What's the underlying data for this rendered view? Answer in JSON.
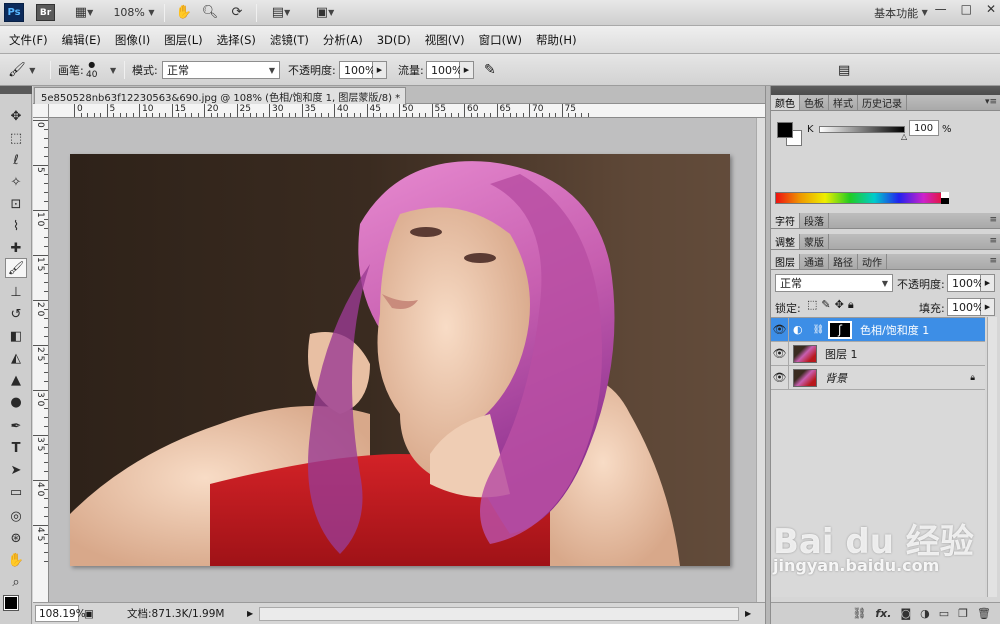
{
  "app_bar": {
    "ps_label": "Ps",
    "br_label": "Br",
    "zoom": "108%",
    "workspace": "基本功能",
    "window_controls": [
      "—",
      "□",
      "✕"
    ]
  },
  "menu": [
    "文件(F)",
    "编辑(E)",
    "图像(I)",
    "图层(L)",
    "选择(S)",
    "滤镜(T)",
    "分析(A)",
    "3D(D)",
    "视图(V)",
    "窗口(W)",
    "帮助(H)"
  ],
  "options": {
    "brush_label": "画笔:",
    "brush_size": "40",
    "mode_label": "模式:",
    "mode_value": "正常",
    "opacity_label": "不透明度:",
    "opacity_value": "100%",
    "flow_label": "流量:",
    "flow_value": "100%"
  },
  "document": {
    "tab_title": "5e850528nb63f12230563&690.jpg @ 108% (色相/饱和度 1, 图层蒙版/8) *",
    "close": "×",
    "ruler_top": [
      "0",
      "5",
      "10",
      "15",
      "20",
      "25",
      "30",
      "35",
      "40",
      "45",
      "50",
      "55",
      "60",
      "65",
      "70",
      "75"
    ],
    "ruler_left": [
      "0",
      "5",
      "1 0",
      "1 5",
      "2 0",
      "2 5",
      "3 0",
      "3 5",
      "4 0",
      "4 5"
    ]
  },
  "status": {
    "zoom": "108.19%",
    "doc_info": "文档:871.3K/1.99M"
  },
  "color_panel": {
    "tabs": [
      "颜色",
      "色板",
      "样式",
      "历史记录"
    ],
    "channel": "K",
    "value": "100",
    "unit": "%"
  },
  "char_panel": {
    "tabs": [
      "字符",
      "段落"
    ]
  },
  "adjust_panel": {
    "tabs": [
      "调整",
      "蒙版"
    ]
  },
  "layers_panel": {
    "tabs": [
      "图层",
      "通道",
      "路径",
      "动作"
    ],
    "blend_mode": "正常",
    "opacity_label": "不透明度:",
    "opacity_value": "100%",
    "lock_label": "锁定:",
    "fill_label": "填充:",
    "fill_value": "100%",
    "layers": [
      {
        "name": "色相/饱和度 1",
        "selected": true,
        "type": "adjustment"
      },
      {
        "name": "图层 1",
        "selected": false,
        "type": "image"
      },
      {
        "name": "背景",
        "selected": false,
        "type": "background",
        "locked": true
      }
    ]
  },
  "watermark": {
    "brand": "Bai du 经验",
    "url": "jingyan.baidu.com"
  },
  "colors": {
    "selected_layer": "#3d8ee6",
    "hair": "#c75fb0",
    "dress": "#b8191d"
  }
}
